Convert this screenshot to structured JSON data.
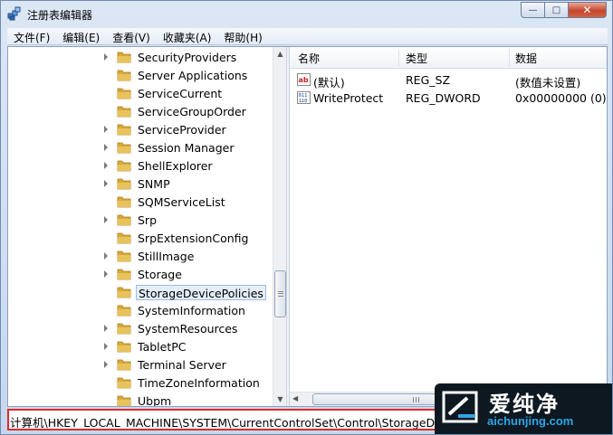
{
  "window": {
    "title": "注册表编辑器"
  },
  "controls": {
    "minimize": "—",
    "maximize": "□",
    "close": "✕"
  },
  "menu": [
    "文件(F)",
    "编辑(E)",
    "查看(V)",
    "收藏夹(A)",
    "帮助(H)"
  ],
  "tree": {
    "items": [
      {
        "label": "SecurityProviders",
        "expandable": true
      },
      {
        "label": "Server Applications",
        "expandable": false
      },
      {
        "label": "ServiceCurrent",
        "expandable": false
      },
      {
        "label": "ServiceGroupOrder",
        "expandable": false
      },
      {
        "label": "ServiceProvider",
        "expandable": true
      },
      {
        "label": "Session Manager",
        "expandable": true
      },
      {
        "label": "ShellExplorer",
        "expandable": true
      },
      {
        "label": "SNMP",
        "expandable": true
      },
      {
        "label": "SQMServiceList",
        "expandable": false
      },
      {
        "label": "Srp",
        "expandable": true
      },
      {
        "label": "SrpExtensionConfig",
        "expandable": false
      },
      {
        "label": "StillImage",
        "expandable": true
      },
      {
        "label": "Storage",
        "expandable": true
      },
      {
        "label": "StorageDevicePolicies",
        "expandable": false,
        "selected": true
      },
      {
        "label": "SystemInformation",
        "expandable": false
      },
      {
        "label": "SystemResources",
        "expandable": true
      },
      {
        "label": "TabletPC",
        "expandable": true
      },
      {
        "label": "Terminal Server",
        "expandable": true
      },
      {
        "label": "TimeZoneInformation",
        "expandable": false
      },
      {
        "label": "Ubpm",
        "expandable": false
      }
    ]
  },
  "list": {
    "columns": [
      "名称",
      "类型",
      "数据"
    ],
    "rows": [
      {
        "icon": "string-value-icon",
        "name": "(默认)",
        "type": "REG_SZ",
        "data": "(数值未设置)"
      },
      {
        "icon": "binary-value-icon",
        "name": "WriteProtect",
        "type": "REG_DWORD",
        "data": "0x00000000 (0)"
      }
    ]
  },
  "status": {
    "path": "计算机\\HKEY_LOCAL_MACHINE\\SYSTEM\\CurrentControlSet\\Control\\StorageDevicePolicies"
  },
  "watermark": {
    "brand": "爱纯净",
    "url": "aichunjing.com"
  },
  "colors": {
    "status_highlight": "#e12a2a",
    "selection_bg": "#e4eefb",
    "folder": "#e8c25a"
  }
}
